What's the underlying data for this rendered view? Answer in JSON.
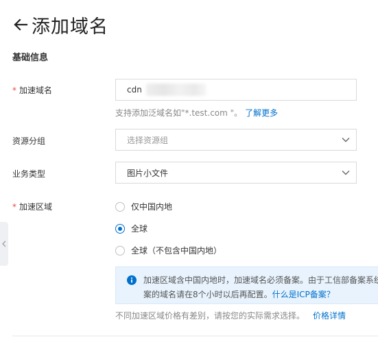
{
  "header": {
    "title": "添加域名",
    "back_icon": "arrow-left-icon"
  },
  "section": {
    "title": "基础信息"
  },
  "domain": {
    "label": "加速域名",
    "required_mark": "*",
    "value": "cdn",
    "hint": "支持添加泛域名如\"*.test.com \"。",
    "hint_link": "了解更多"
  },
  "resource_group": {
    "label": "资源分组",
    "placeholder": "选择资源组"
  },
  "business_type": {
    "label": "业务类型",
    "value": "图片小文件"
  },
  "region": {
    "label": "加速区域",
    "required_mark": "*",
    "options": [
      {
        "label": "仅中国内地",
        "checked": false
      },
      {
        "label": "全球",
        "checked": true
      },
      {
        "label": "全球（不包含中国内地）",
        "checked": false
      }
    ]
  },
  "info": {
    "line1": "加速区域含中国内地时，加速域名必须备案。由于工信部备案系统",
    "line2": "案的域名请在8个小时以后再配置。",
    "link": "什么是ICP备案？"
  },
  "pricing": {
    "note": "不同加速区域价格有差别，请按您的实际需求选择。",
    "link": "价格详情"
  },
  "colors": {
    "accent": "#0070cc",
    "required": "#e1504a",
    "info_bg": "#e8f3fd"
  }
}
